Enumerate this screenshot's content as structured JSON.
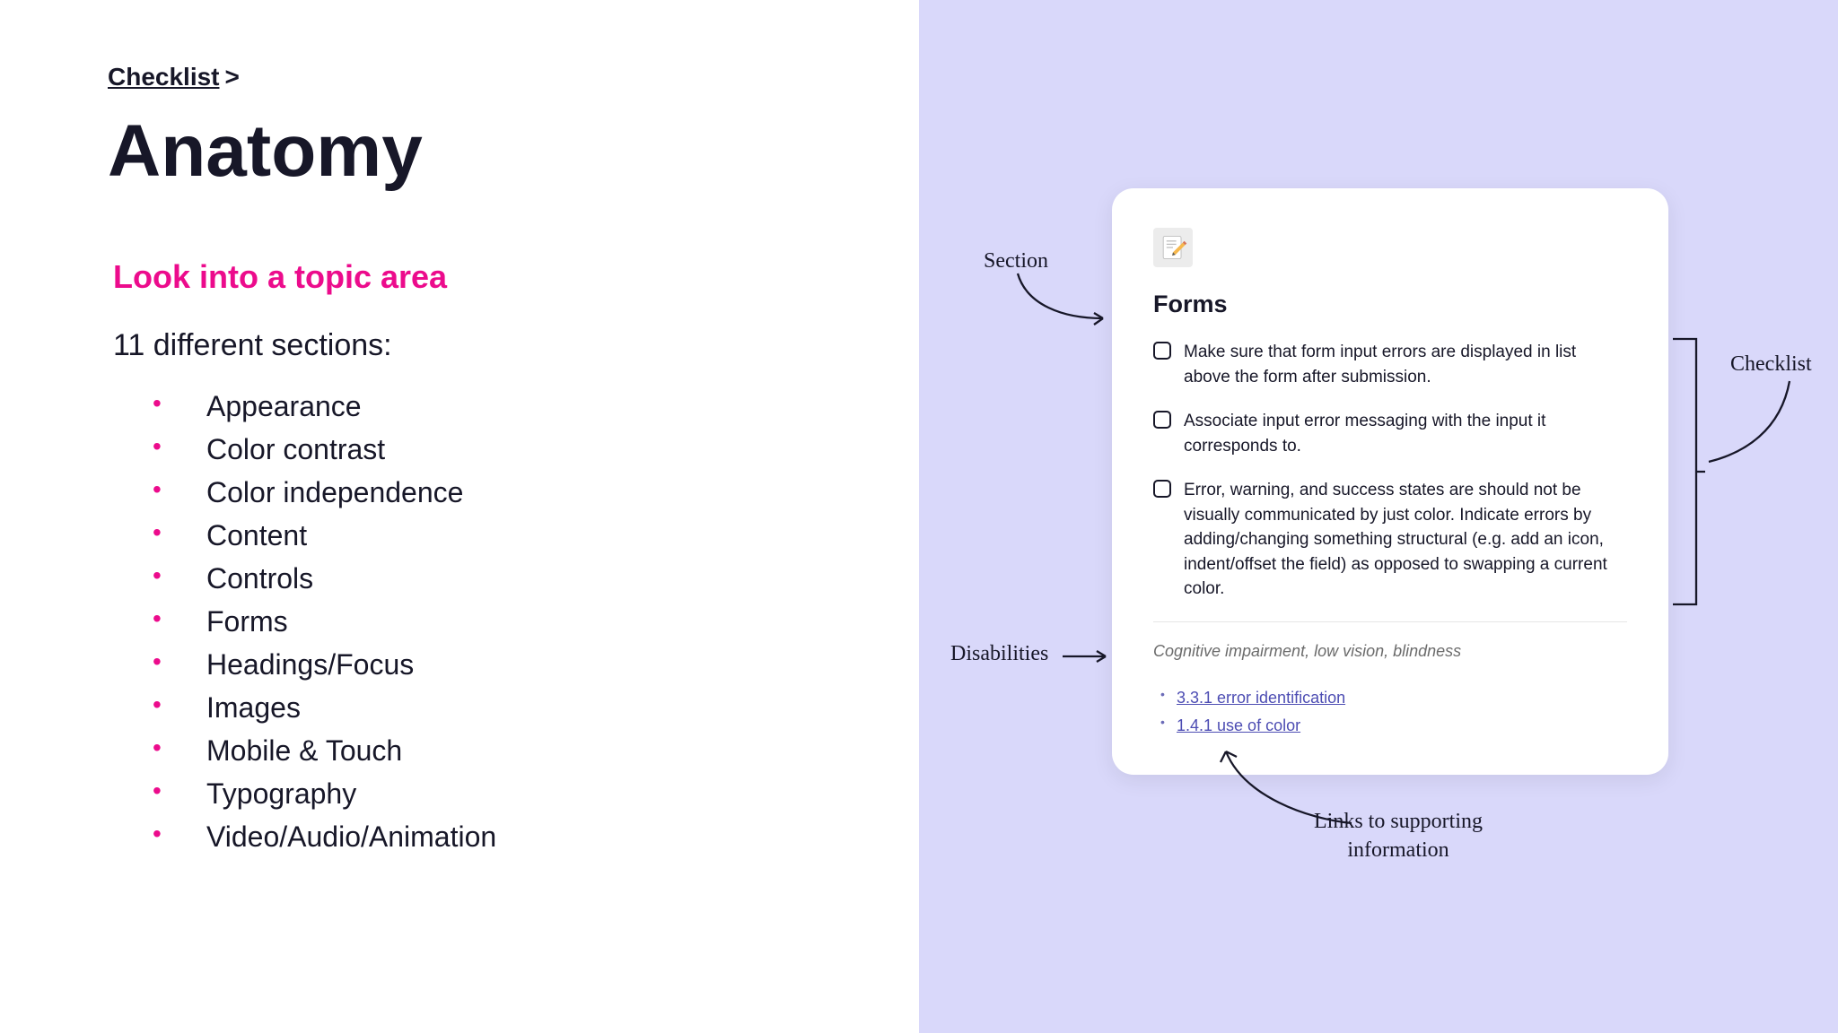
{
  "breadcrumb": {
    "label": "Checklist",
    "caret": ">"
  },
  "title": "Anatomy",
  "subtitle": "Look into a topic area",
  "sections_count_text": "11 different sections:",
  "sections": [
    "Appearance",
    "Color contrast",
    "Color independence",
    "Content",
    "Controls",
    "Forms",
    "Headings/Focus",
    "Images",
    "Mobile & Touch",
    "Typography",
    "Video/Audio/Animation"
  ],
  "card": {
    "title": "Forms",
    "items": [
      "Make sure that form input errors are displayed in list above the form after submission.",
      "Associate input error messaging with the input it corresponds to.",
      "Error, warning, and success states are should not be visually communicated by just color. Indicate errors by adding/changing something structural (e.g. add an icon, indent/offset the field) as opposed to swapping a current color."
    ],
    "disabilities_text": "Cognitive impairment, low vision, blindness",
    "links": [
      "3.3.1 error identification",
      "1.4.1 use of color"
    ]
  },
  "annotations": {
    "section": "Section",
    "disabilities": "Disabilities",
    "checklist": "Checklist",
    "links_line1": "Links to supporting",
    "links_line2": "information"
  }
}
